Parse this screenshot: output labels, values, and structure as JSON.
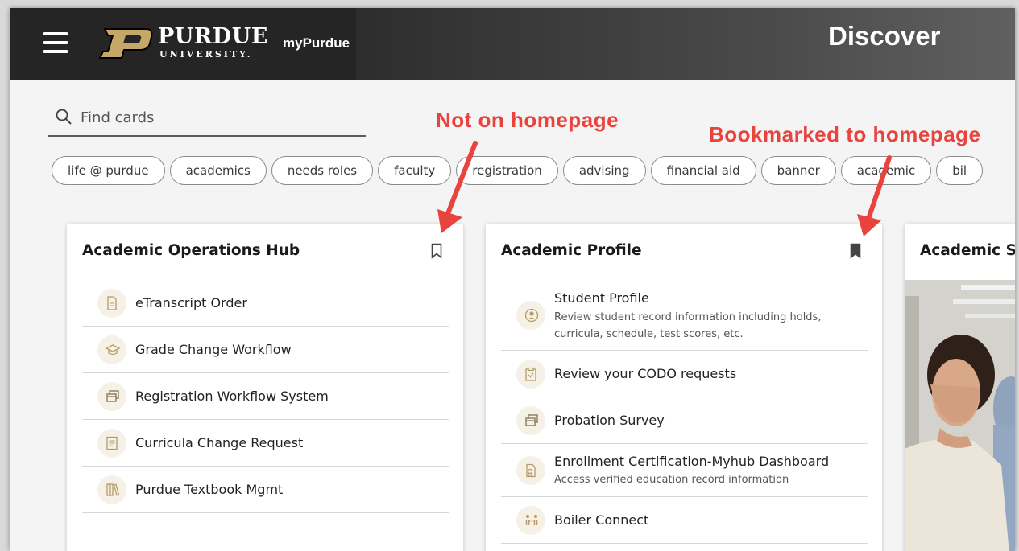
{
  "header": {
    "brand_name": "PURDUE",
    "brand_sub": "UNIVERSITY.",
    "app_name": "myPurdue",
    "page_title": "Discover"
  },
  "search": {
    "placeholder": "Find cards"
  },
  "chips": [
    "life @ purdue",
    "academics",
    "needs roles",
    "faculty",
    "registration",
    "advising",
    "financial aid",
    "banner",
    "academic",
    "bil"
  ],
  "annotations": {
    "not_on_homepage": "Not on homepage",
    "bookmarked": "Bookmarked to homepage"
  },
  "cards": [
    {
      "title": "Academic Operations Hub",
      "bookmarked": false,
      "items": [
        {
          "label": "eTranscript Order",
          "icon": "document-icon"
        },
        {
          "label": "Grade Change Workflow",
          "icon": "graduation-cap-icon"
        },
        {
          "label": "Registration Workflow System",
          "icon": "windows-icon"
        },
        {
          "label": "Curricula Change Request",
          "icon": "list-document-icon"
        },
        {
          "label": "Purdue Textbook Mgmt",
          "icon": "books-icon"
        }
      ]
    },
    {
      "title": "Academic Profile",
      "bookmarked": true,
      "items": [
        {
          "label": "Student Profile",
          "desc": "Review student record information including holds, curricula, schedule, test scores, etc.",
          "icon": "user-circle-icon"
        },
        {
          "label": "Review your CODO requests",
          "icon": "clipboard-check-icon"
        },
        {
          "label": "Probation Survey",
          "icon": "windows-icon"
        },
        {
          "label": "Enrollment Certification-Myhub Dashboard",
          "desc": "Access verified education record information",
          "icon": "certificate-icon"
        },
        {
          "label": "Boiler Connect",
          "icon": "people-connect-icon"
        }
      ]
    },
    {
      "title": "Academic S",
      "bookmarked": false,
      "items": []
    }
  ],
  "colors": {
    "accent": "#e9433e",
    "gold": "#c5a767",
    "header_dark": "#252525"
  }
}
